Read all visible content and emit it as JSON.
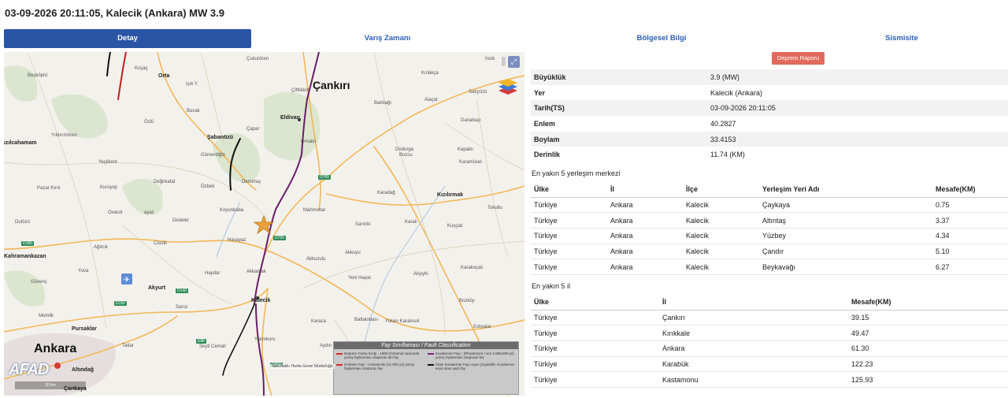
{
  "header": {
    "title": "03-09-2026 20:11:05, Kalecik (Ankara) MW 3.9"
  },
  "tabs": [
    {
      "label": "Detay",
      "active": true
    },
    {
      "label": "Varış Zamanı",
      "active": false
    },
    {
      "label": "Bölgesel Bilgi",
      "active": false
    },
    {
      "label": "Sismisite",
      "active": false
    }
  ],
  "map": {
    "labels": {
      "cankiri": "Çankırı",
      "ankara": "Ankara",
      "kizilirmak": "Kızılırmak",
      "kalecik": "Kalecik",
      "eldivan": "Eldivan",
      "orta": "Orta",
      "sabanozu": "Şabanözü",
      "akyurt": "Akyurt",
      "pursaklar": "Pursaklar",
      "altindag": "Altındağ",
      "cankaya": "Çankaya",
      "kizilcahamam": "ızılcahamam",
      "kahramankazan": "Kahramankazan",
      "cukurongen": "Çukurören",
      "kirlakca": "Kırlakça",
      "satiyuzu": "Satıyüzü",
      "ciftlikkoy": "Çiftlikköy",
      "balibagi": "Balıbağı",
      "alacat": "Alaçat",
      "danabasi": "Danabaşı",
      "cemen": "Çapar",
      "ozlu": "Özlü",
      "yildirimoren": "Yıldırımören",
      "yesilkent": "Yeşilkent",
      "pazar_kirik": "Pazar Kırık",
      "kuruyay": "Kuruyay",
      "degirmen": "Değirkafat",
      "ovacik": "Ovacık",
      "ayaz": "ayaz",
      "dedeler": "Dedeler",
      "koyunbaba": "Koyunbaba",
      "hasayaz": "Hasayaz",
      "mahmutlar": "Mahmutlar",
      "sarinbi": "Sarınbi",
      "karali": "Karalı",
      "kuscali": "Kuşçalı",
      "tokullu": "Tokullu",
      "akkuzulu": "Akkuzulu",
      "akkuyu": "Akkuyu",
      "yenihayat": "Yeni Hayat",
      "alisiyhi": "Alişiyhi",
      "karakocali": "Karakoçalı",
      "cucuk": "Cücük",
      "haydar": "Haydar",
      "akkamak": "Akkamak",
      "saruc": "Saruc",
      "memlik": "Memlik",
      "tatlar": "Tatlar",
      "seyti_cemali": "Seyti Cemali",
      "karaca": "Karaca",
      "battalobasi": "Battalobası",
      "yukari_karakisik": "Yukarı Karakısık",
      "bozkoy": "Bozköy",
      "evliyalar": "Evliyalar",
      "aydin": "Aydın",
      "yalimkoru": "Yalımkoru",
      "dutozu": "Dutözü",
      "agilcik": "Ağılcık",
      "guvenc": "Güvenç",
      "yuva": "Yuva",
      "gumerdigin": "Gümerdiğin",
      "ozbek": "Özbek",
      "demirtas": "Demirtaş",
      "dodurga": "Dodurga",
      "karaday": "Karadağ",
      "besiktas": "Beşköprü",
      "kosac": "Koşaç",
      "inlik": "İncik",
      "bucak": "Bucak",
      "isik": "Işık Y.",
      "omalı": "Ömaklı",
      "bozcu": "Bozcu",
      "kavak": "Kapaklı",
      "karamusel": "Karamüsel"
    },
    "roads": {
      "d765a": "D765",
      "d765b": "D765",
      "d140": "D140",
      "d150": "D150",
      "d180": "D180",
      "e88": "E88",
      "d200": "D200"
    },
    "legend": {
      "title": "Fay Sınıflaması / Fault Classification",
      "col1": [
        {
          "color": "#d42a2a",
          "text": "Deprem Yüzey Kırığı : 1900-Günümüz arasında yüzey faylanması oluşturan diri fay"
        },
        {
          "color": "#d42a2a",
          "text": "Holosen Fayı : Holosen'de (11.000 yıl) yüzey faylanması oluşturan fay"
        }
      ],
      "col2": [
        {
          "color": "#7a1f7a",
          "text": "Kuvaterner Fayı : (Pleyistosen / son 2.588.000 yıl) yüzey faylanması oluşturan fay"
        },
        {
          "color": "#111111",
          "text": "Olası Kuvaterner Fayı veya Çizgisellik: Kuvaterner veya olası yaşlı fay"
        }
      ]
    },
    "attribution": "Telif Hakkı Harita Genel Müdürlüğü",
    "logo": "AFAD",
    "scale": "20 km"
  },
  "report_button": "Deprem Raporu",
  "details": [
    {
      "key": "Büyüklük",
      "value": "3.9 (MW)"
    },
    {
      "key": "Yer",
      "value": "Kalecik (Ankara)"
    },
    {
      "key": "Tarih(TS)",
      "value": "03-09-2026 20:11:05"
    },
    {
      "key": "Enlem",
      "value": "40.2827"
    },
    {
      "key": "Boylam",
      "value": "33.4153"
    },
    {
      "key": "Derinlik",
      "value": "11.74 (KM)"
    }
  ],
  "settlements": {
    "title": "En yakın 5 yerleşim merkezi",
    "headers": [
      "Ülke",
      "İl",
      "İlçe",
      "Yerleşim Yeri Adı",
      "Mesafe(KM)"
    ],
    "rows": [
      [
        "Türkiye",
        "Ankara",
        "Kalecik",
        "Çaykaya",
        "0.75"
      ],
      [
        "Türkiye",
        "Ankara",
        "Kalecik",
        "Altıntaş",
        "3.37"
      ],
      [
        "Türkiye",
        "Ankara",
        "Kalecik",
        "Yüzbey",
        "4.34"
      ],
      [
        "Türkiye",
        "Ankara",
        "Kalecik",
        "Çandır",
        "5.10"
      ],
      [
        "Türkiye",
        "Ankara",
        "Kalecik",
        "Beykavağı",
        "6.27"
      ]
    ]
  },
  "provinces": {
    "title": "En yakın 5 il",
    "headers": [
      "Ülke",
      "İl",
      "Mesafe(KM)"
    ],
    "rows": [
      [
        "Türkiye",
        "Çankırı",
        "39.15"
      ],
      [
        "Türkiye",
        "Kırıkkale",
        "49.47"
      ],
      [
        "Türkiye",
        "Ankara",
        "61.30"
      ],
      [
        "Türkiye",
        "Karabük",
        "122.23"
      ],
      [
        "Türkiye",
        "Kastamonu",
        "125.93"
      ]
    ]
  }
}
